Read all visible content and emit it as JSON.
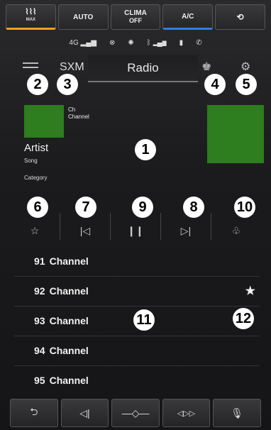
{
  "climate": [
    {
      "label": "MAX",
      "sub": "",
      "accent": "orange"
    },
    {
      "label": "AUTO",
      "sub": "",
      "accent": ""
    },
    {
      "label": "CLIMA",
      "sub": "OFF",
      "accent": ""
    },
    {
      "label": "A/C",
      "sub": "",
      "accent": "blue"
    },
    {
      "label": "",
      "sub": "",
      "accent": ""
    }
  ],
  "status": {
    "signal": "4G"
  },
  "nav": {
    "source_label": "SXM",
    "tab_label": "Radio"
  },
  "now_playing": {
    "ch_label": "Ch",
    "channel_label": "Channel",
    "artist": "Artist",
    "song": "Song",
    "category": "Category"
  },
  "channels": [
    {
      "number": "91",
      "name": "Channel"
    },
    {
      "number": "92",
      "name": "Channel"
    },
    {
      "number": "93",
      "name": "Channel"
    },
    {
      "number": "94",
      "name": "Channel"
    },
    {
      "number": "95",
      "name": "Channel"
    }
  ],
  "callouts": [
    "1",
    "2",
    "3",
    "4",
    "5",
    "6",
    "7",
    "8",
    "9",
    "10",
    "11",
    "12"
  ]
}
